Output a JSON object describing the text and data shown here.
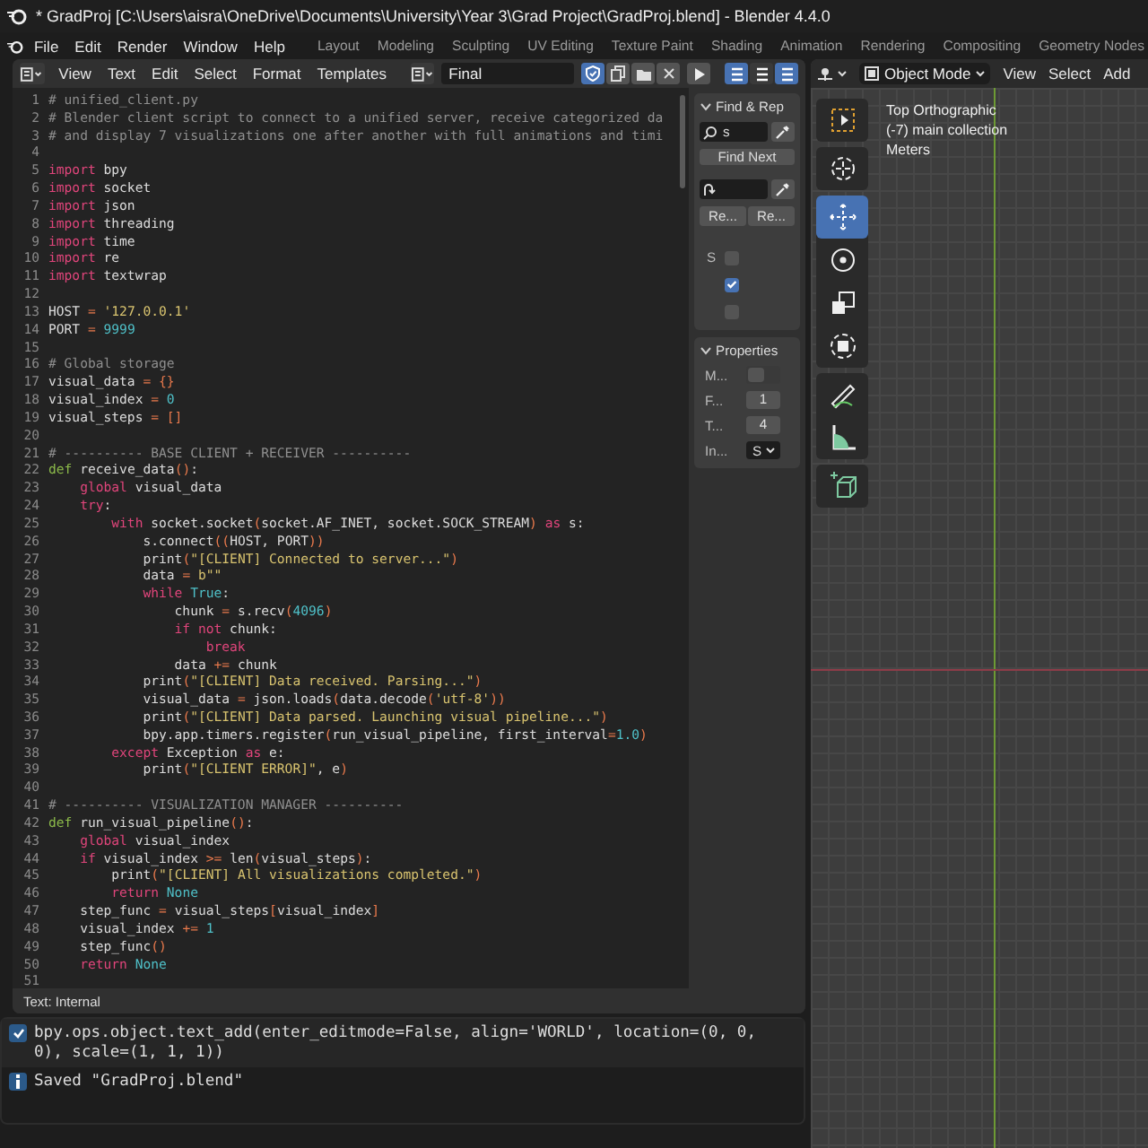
{
  "window": {
    "title": "* GradProj [C:\\Users\\aisra\\OneDrive\\Documents\\University\\Year 3\\Grad Project\\GradProj.blend] - Blender 4.4.0"
  },
  "menu": [
    "File",
    "Edit",
    "Render",
    "Window",
    "Help"
  ],
  "workspaces": [
    {
      "label": "Layout",
      "selected": false
    },
    {
      "label": "Modeling",
      "selected": false
    },
    {
      "label": "Sculpting",
      "selected": false
    },
    {
      "label": "UV Editing",
      "selected": false
    },
    {
      "label": "Texture Paint",
      "selected": false
    },
    {
      "label": "Shading",
      "selected": false
    },
    {
      "label": "Animation",
      "selected": false
    },
    {
      "label": "Rendering",
      "selected": false
    },
    {
      "label": "Compositing",
      "selected": false
    },
    {
      "label": "Geometry Nodes",
      "selected": false
    }
  ],
  "text_editor": {
    "menus": [
      "View",
      "Text",
      "Edit",
      "Select",
      "Format",
      "Templates"
    ],
    "text_name": "Final",
    "fake_user": true,
    "view_toggles": [
      {
        "on": true
      },
      {
        "on": false
      },
      {
        "on": true
      }
    ],
    "lines": [
      {
        "n": "1",
        "tokens": [
          {
            "kind": "comment",
            "text": "# unified_client.py"
          }
        ]
      },
      {
        "n": "2",
        "tokens": [
          {
            "kind": "comment",
            "text": "# Blender client script to connect to a unified server, receive categorized da"
          }
        ]
      },
      {
        "n": "3",
        "tokens": [
          {
            "kind": "comment",
            "text": "# and display 7 visualizations one after another with full animations and timi"
          }
        ]
      },
      {
        "n": "4"
      },
      {
        "n": "5",
        "tokens": [
          {
            "kind": "kw",
            "text": "import"
          },
          {
            "kind": "plain",
            "text": " bpy"
          }
        ]
      },
      {
        "n": "6",
        "tokens": [
          {
            "kind": "kw",
            "text": "import"
          },
          {
            "kind": "plain",
            "text": " socket"
          }
        ]
      },
      {
        "n": "7",
        "tokens": [
          {
            "kind": "kw",
            "text": "import"
          },
          {
            "kind": "plain",
            "text": " json"
          }
        ]
      },
      {
        "n": "8",
        "tokens": [
          {
            "kind": "kw",
            "text": "import"
          },
          {
            "kind": "plain",
            "text": " threading"
          }
        ]
      },
      {
        "n": "9",
        "tokens": [
          {
            "kind": "kw",
            "text": "import"
          },
          {
            "kind": "plain",
            "text": " time"
          }
        ]
      },
      {
        "n": "10",
        "tokens": [
          {
            "kind": "kw",
            "text": "import"
          },
          {
            "kind": "plain",
            "text": " re"
          }
        ]
      },
      {
        "n": "11",
        "tokens": [
          {
            "kind": "kw",
            "text": "import"
          },
          {
            "kind": "plain",
            "text": " textwrap"
          }
        ]
      },
      {
        "n": "12"
      },
      {
        "n": "13",
        "tokens": [
          {
            "kind": "plain",
            "text": "HOST "
          },
          {
            "kind": "op",
            "text": "="
          },
          {
            "kind": "str",
            "text": " '127.0.0.1'"
          }
        ]
      },
      {
        "n": "14",
        "tokens": [
          {
            "kind": "plain",
            "text": "PORT "
          },
          {
            "kind": "op",
            "text": "="
          },
          {
            "kind": "num",
            "text": " 9999"
          }
        ]
      },
      {
        "n": "15"
      },
      {
        "n": "16",
        "tokens": [
          {
            "kind": "comment",
            "text": "# Global storage"
          }
        ]
      },
      {
        "n": "17",
        "tokens": [
          {
            "kind": "plain",
            "text": "visual_data "
          },
          {
            "kind": "op",
            "text": "= {}"
          }
        ]
      },
      {
        "n": "18",
        "tokens": [
          {
            "kind": "plain",
            "text": "visual_index "
          },
          {
            "kind": "op",
            "text": "="
          },
          {
            "kind": "num",
            "text": " 0"
          }
        ]
      },
      {
        "n": "19",
        "tokens": [
          {
            "kind": "plain",
            "text": "visual_steps "
          },
          {
            "kind": "op",
            "text": "= []"
          }
        ]
      },
      {
        "n": "20"
      },
      {
        "n": "21",
        "tokens": [
          {
            "kind": "comment",
            "text": "# ---------- BASE CLIENT + RECEIVER ----------"
          }
        ]
      },
      {
        "n": "22",
        "tokens": [
          {
            "kind": "def",
            "text": "def"
          },
          {
            "kind": "plain",
            "text": " receive_data"
          },
          {
            "kind": "op",
            "text": "()"
          },
          {
            "kind": "plain",
            "text": ":"
          }
        ]
      },
      {
        "n": "23",
        "tokens": [
          {
            "kind": "kw",
            "text": "    global"
          },
          {
            "kind": "plain",
            "text": " visual_data"
          }
        ]
      },
      {
        "n": "24",
        "tokens": [
          {
            "kind": "kw",
            "text": "    try"
          },
          {
            "kind": "plain",
            "text": ":"
          }
        ]
      },
      {
        "n": "25",
        "tokens": [
          {
            "kind": "kw",
            "text": "        with"
          },
          {
            "kind": "plain",
            "text": " socket.socket"
          },
          {
            "kind": "op",
            "text": "("
          },
          {
            "kind": "plain",
            "text": "socket.AF_INET, socket.SOCK_STREAM"
          },
          {
            "kind": "op",
            "text": ")"
          },
          {
            "kind": "kw",
            "text": " as"
          },
          {
            "kind": "plain",
            "text": " s:"
          }
        ]
      },
      {
        "n": "26",
        "tokens": [
          {
            "kind": "plain",
            "text": "            s.connect"
          },
          {
            "kind": "op",
            "text": "(("
          },
          {
            "kind": "plain",
            "text": "HOST, PORT"
          },
          {
            "kind": "op",
            "text": "))"
          }
        ]
      },
      {
        "n": "27",
        "tokens": [
          {
            "kind": "plain",
            "text": "            print"
          },
          {
            "kind": "op",
            "text": "("
          },
          {
            "kind": "str",
            "text": "\"[CLIENT] Connected to server...\""
          },
          {
            "kind": "op",
            "text": ")"
          }
        ]
      },
      {
        "n": "28",
        "tokens": [
          {
            "kind": "plain",
            "text": "            data "
          },
          {
            "kind": "op",
            "text": "="
          },
          {
            "kind": "str",
            "text": " b\"\""
          }
        ]
      },
      {
        "n": "29",
        "tokens": [
          {
            "kind": "kw",
            "text": "            while"
          },
          {
            "kind": "num",
            "text": " True"
          },
          {
            "kind": "plain",
            "text": ":"
          }
        ]
      },
      {
        "n": "30",
        "tokens": [
          {
            "kind": "plain",
            "text": "                chunk "
          },
          {
            "kind": "op",
            "text": "="
          },
          {
            "kind": "plain",
            "text": " s.recv"
          },
          {
            "kind": "op",
            "text": "("
          },
          {
            "kind": "num",
            "text": "4096"
          },
          {
            "kind": "op",
            "text": ")"
          }
        ]
      },
      {
        "n": "31",
        "tokens": [
          {
            "kind": "kw",
            "text": "                if not"
          },
          {
            "kind": "plain",
            "text": " chunk:"
          }
        ]
      },
      {
        "n": "32",
        "tokens": [
          {
            "kind": "kw",
            "text": "                    break"
          }
        ]
      },
      {
        "n": "33",
        "tokens": [
          {
            "kind": "plain",
            "text": "                data "
          },
          {
            "kind": "op",
            "text": "+="
          },
          {
            "kind": "plain",
            "text": " chunk"
          }
        ]
      },
      {
        "n": "34",
        "tokens": [
          {
            "kind": "plain",
            "text": "            print"
          },
          {
            "kind": "op",
            "text": "("
          },
          {
            "kind": "str",
            "text": "\"[CLIENT] Data received. Parsing...\""
          },
          {
            "kind": "op",
            "text": ")"
          }
        ]
      },
      {
        "n": "35",
        "tokens": [
          {
            "kind": "plain",
            "text": "            visual_data "
          },
          {
            "kind": "op",
            "text": "="
          },
          {
            "kind": "plain",
            "text": " json.loads"
          },
          {
            "kind": "op",
            "text": "("
          },
          {
            "kind": "plain",
            "text": "data.decode"
          },
          {
            "kind": "op",
            "text": "("
          },
          {
            "kind": "str",
            "text": "'utf-8'"
          },
          {
            "kind": "op",
            "text": "))"
          }
        ]
      },
      {
        "n": "36",
        "tokens": [
          {
            "kind": "plain",
            "text": "            print"
          },
          {
            "kind": "op",
            "text": "("
          },
          {
            "kind": "str",
            "text": "\"[CLIENT] Data parsed. Launching visual pipeline...\""
          },
          {
            "kind": "op",
            "text": ")"
          }
        ]
      },
      {
        "n": "37",
        "tokens": [
          {
            "kind": "plain",
            "text": "            bpy.app.timers.register"
          },
          {
            "kind": "op",
            "text": "("
          },
          {
            "kind": "plain",
            "text": "run_visual_pipeline, first_interval"
          },
          {
            "kind": "op",
            "text": "="
          },
          {
            "kind": "num",
            "text": "1.0"
          },
          {
            "kind": "op",
            "text": ")"
          }
        ]
      },
      {
        "n": "38",
        "tokens": [
          {
            "kind": "kw",
            "text": "        except"
          },
          {
            "kind": "plain",
            "text": " Exception"
          },
          {
            "kind": "kw",
            "text": " as"
          },
          {
            "kind": "plain",
            "text": " e:"
          }
        ]
      },
      {
        "n": "39",
        "tokens": [
          {
            "kind": "plain",
            "text": "            print"
          },
          {
            "kind": "op",
            "text": "("
          },
          {
            "kind": "str",
            "text": "\"[CLIENT ERROR]\""
          },
          {
            "kind": "plain",
            "text": ", e"
          },
          {
            "kind": "op",
            "text": ")"
          }
        ]
      },
      {
        "n": "40"
      },
      {
        "n": "41",
        "tokens": [
          {
            "kind": "comment",
            "text": "# ---------- VISUALIZATION MANAGER ----------"
          }
        ]
      },
      {
        "n": "42",
        "tokens": [
          {
            "kind": "def",
            "text": "def"
          },
          {
            "kind": "plain",
            "text": " run_visual_pipeline"
          },
          {
            "kind": "op",
            "text": "()"
          },
          {
            "kind": "plain",
            "text": ":"
          }
        ]
      },
      {
        "n": "43",
        "tokens": [
          {
            "kind": "kw",
            "text": "    global"
          },
          {
            "kind": "plain",
            "text": " visual_index"
          }
        ]
      },
      {
        "n": "44",
        "tokens": [
          {
            "kind": "kw",
            "text": "    if"
          },
          {
            "kind": "plain",
            "text": " visual_index "
          },
          {
            "kind": "op",
            "text": ">="
          },
          {
            "kind": "plain",
            "text": " len"
          },
          {
            "kind": "op",
            "text": "("
          },
          {
            "kind": "plain",
            "text": "visual_steps"
          },
          {
            "kind": "op",
            "text": ")"
          },
          {
            "kind": "plain",
            "text": ":"
          }
        ]
      },
      {
        "n": "45",
        "tokens": [
          {
            "kind": "plain",
            "text": "        print"
          },
          {
            "kind": "op",
            "text": "("
          },
          {
            "kind": "str",
            "text": "\"[CLIENT] All visualizations completed.\""
          },
          {
            "kind": "op",
            "text": ")"
          }
        ]
      },
      {
        "n": "46",
        "tokens": [
          {
            "kind": "kw",
            "text": "        return"
          },
          {
            "kind": "num",
            "text": " None"
          }
        ]
      },
      {
        "n": "47",
        "tokens": [
          {
            "kind": "plain",
            "text": "    step_func "
          },
          {
            "kind": "op",
            "text": "="
          },
          {
            "kind": "plain",
            "text": " visual_steps"
          },
          {
            "kind": "op",
            "text": "["
          },
          {
            "kind": "plain",
            "text": "visual_index"
          },
          {
            "kind": "op",
            "text": "]"
          }
        ]
      },
      {
        "n": "48",
        "tokens": [
          {
            "kind": "plain",
            "text": "    visual_index "
          },
          {
            "kind": "op",
            "text": "+="
          },
          {
            "kind": "num",
            "text": " 1"
          }
        ]
      },
      {
        "n": "49",
        "tokens": [
          {
            "kind": "plain",
            "text": "    step_func"
          },
          {
            "kind": "op",
            "text": "()"
          }
        ]
      },
      {
        "n": "50",
        "tokens": [
          {
            "kind": "kw",
            "text": "    return"
          },
          {
            "kind": "num",
            "text": " None"
          }
        ]
      },
      {
        "n": "51"
      }
    ],
    "sidebar": {
      "find_panel": {
        "title": "Find & Rep",
        "expanded": true,
        "find_value": "s",
        "find_button": "Find Next",
        "replace_buttons": [
          "Re...",
          "Re..."
        ],
        "checkboxes": [
          {
            "label": "S",
            "checked": false
          },
          {
            "checked": true
          },
          {
            "checked": false
          }
        ]
      },
      "properties_panel": {
        "title": "Properties",
        "expanded": true,
        "rows": [
          {
            "kind": "toggle",
            "label": "M...",
            "on": false
          },
          {
            "kind": "number",
            "label": "F...",
            "value": "1"
          },
          {
            "kind": "number",
            "label": "T...",
            "value": "4"
          },
          {
            "kind": "dropdown",
            "label": "In...",
            "value": "S"
          }
        ]
      }
    },
    "footer": "Text: Internal"
  },
  "info": {
    "reports": [
      {
        "kind": "operator",
        "text": "bpy.ops.object.text_add(enter_editmode=False, align='WORLD', location=(0, 0, 0), scale=(1, 1, 1))"
      },
      {
        "kind": "info",
        "text": "Saved \"GradProj.blend\""
      }
    ]
  },
  "viewport": {
    "mode": "Object Mode",
    "menus": [
      "View",
      "Select",
      "Add"
    ],
    "overlay": [
      "Top Orthographic",
      "(-7) main collection",
      "Meters"
    ],
    "tools": [
      {
        "selected": false
      },
      {
        "selected": false
      },
      {
        "selected": true
      },
      {
        "selected": false
      },
      {
        "selected": false
      },
      {
        "selected": false
      },
      {
        "selected": false
      },
      {
        "selected": false
      },
      {
        "selected": false
      }
    ]
  }
}
